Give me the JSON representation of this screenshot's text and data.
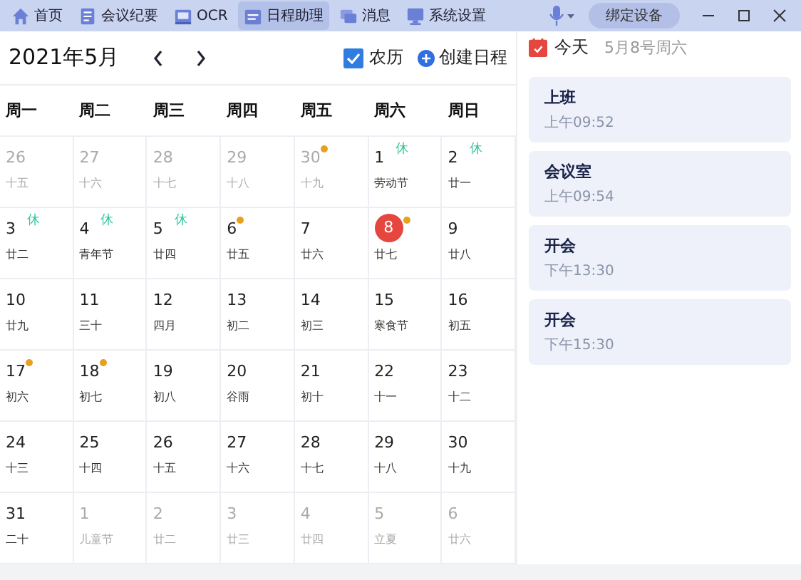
{
  "nav": [
    {
      "label": "首页",
      "selected": false
    },
    {
      "label": "会议纪要",
      "selected": false
    },
    {
      "label": "OCR",
      "selected": false
    },
    {
      "label": "日程助理",
      "selected": true
    },
    {
      "label": "消息",
      "selected": false
    },
    {
      "label": "系统设置",
      "selected": false
    }
  ],
  "bind_button": "绑定设备",
  "calendar": {
    "title": "2021年5月",
    "lunar_toggle": {
      "label": "农历",
      "checked": true
    },
    "create_button": "创建日程",
    "weekdays": [
      "周一",
      "周二",
      "周三",
      "周四",
      "周五",
      "周六",
      "周日"
    ],
    "weeks": [
      [
        {
          "day": "26",
          "lunar": "十五",
          "other_month": true,
          "event": false,
          "today": false
        },
        {
          "day": "27",
          "lunar": "十六",
          "other_month": true,
          "event": false,
          "today": false
        },
        {
          "day": "28",
          "lunar": "十七",
          "other_month": true,
          "event": false,
          "today": false
        },
        {
          "day": "29",
          "lunar": "十八",
          "other_month": true,
          "event": false,
          "today": false
        },
        {
          "day": "30",
          "lunar": "十九",
          "other_month": true,
          "event": true,
          "today": false
        },
        {
          "day": "1",
          "lunar": "劳动节",
          "other_month": false,
          "event": false,
          "today": false,
          "badge": "休"
        },
        {
          "day": "2",
          "lunar": "廿一",
          "other_month": false,
          "event": false,
          "today": false,
          "badge": "休"
        }
      ],
      [
        {
          "day": "3",
          "lunar": "廿二",
          "other_month": false,
          "event": false,
          "today": false,
          "badge": "休"
        },
        {
          "day": "4",
          "lunar": "青年节",
          "other_month": false,
          "event": false,
          "today": false,
          "badge": "休"
        },
        {
          "day": "5",
          "lunar": "廿四",
          "other_month": false,
          "event": false,
          "today": false,
          "badge": "休"
        },
        {
          "day": "6",
          "lunar": "廿五",
          "other_month": false,
          "event": true,
          "today": false
        },
        {
          "day": "7",
          "lunar": "廿六",
          "other_month": false,
          "event": false,
          "today": false
        },
        {
          "day": "8",
          "lunar": "廿七",
          "other_month": false,
          "event": true,
          "today": true
        },
        {
          "day": "9",
          "lunar": "廿八",
          "other_month": false,
          "event": false,
          "today": false
        }
      ],
      [
        {
          "day": "10",
          "lunar": "廿九",
          "other_month": false,
          "event": false,
          "today": false
        },
        {
          "day": "11",
          "lunar": "三十",
          "other_month": false,
          "event": false,
          "today": false
        },
        {
          "day": "12",
          "lunar": "四月",
          "other_month": false,
          "event": false,
          "today": false
        },
        {
          "day": "13",
          "lunar": "初二",
          "other_month": false,
          "event": false,
          "today": false
        },
        {
          "day": "14",
          "lunar": "初三",
          "other_month": false,
          "event": false,
          "today": false
        },
        {
          "day": "15",
          "lunar": "寒食节",
          "other_month": false,
          "event": false,
          "today": false
        },
        {
          "day": "16",
          "lunar": "初五",
          "other_month": false,
          "event": false,
          "today": false
        }
      ],
      [
        {
          "day": "17",
          "lunar": "初六",
          "other_month": false,
          "event": true,
          "today": false
        },
        {
          "day": "18",
          "lunar": "初七",
          "other_month": false,
          "event": true,
          "today": false
        },
        {
          "day": "19",
          "lunar": "初八",
          "other_month": false,
          "event": false,
          "today": false
        },
        {
          "day": "20",
          "lunar": "谷雨",
          "other_month": false,
          "event": false,
          "today": false
        },
        {
          "day": "21",
          "lunar": "初十",
          "other_month": false,
          "event": false,
          "today": false
        },
        {
          "day": "22",
          "lunar": "十一",
          "other_month": false,
          "event": false,
          "today": false
        },
        {
          "day": "23",
          "lunar": "十二",
          "other_month": false,
          "event": false,
          "today": false
        }
      ],
      [
        {
          "day": "24",
          "lunar": "十三",
          "other_month": false,
          "event": false,
          "today": false
        },
        {
          "day": "25",
          "lunar": "十四",
          "other_month": false,
          "event": false,
          "today": false
        },
        {
          "day": "26",
          "lunar": "十五",
          "other_month": false,
          "event": false,
          "today": false
        },
        {
          "day": "27",
          "lunar": "十六",
          "other_month": false,
          "event": false,
          "today": false
        },
        {
          "day": "28",
          "lunar": "十七",
          "other_month": false,
          "event": false,
          "today": false
        },
        {
          "day": "29",
          "lunar": "十八",
          "other_month": false,
          "event": false,
          "today": false
        },
        {
          "day": "30",
          "lunar": "十九",
          "other_month": false,
          "event": false,
          "today": false
        }
      ],
      [
        {
          "day": "31",
          "lunar": "二十",
          "other_month": false,
          "event": false,
          "today": false
        },
        {
          "day": "1",
          "lunar": "儿童节",
          "other_month": true,
          "event": false,
          "today": false
        },
        {
          "day": "2",
          "lunar": "廿二",
          "other_month": true,
          "event": false,
          "today": false
        },
        {
          "day": "3",
          "lunar": "廿三",
          "other_month": true,
          "event": false,
          "today": false
        },
        {
          "day": "4",
          "lunar": "廿四",
          "other_month": true,
          "event": false,
          "today": false
        },
        {
          "day": "5",
          "lunar": "立夏",
          "other_month": true,
          "event": false,
          "today": false
        },
        {
          "day": "6",
          "lunar": "廿六",
          "other_month": true,
          "event": false,
          "today": false
        }
      ]
    ]
  },
  "today_panel": {
    "title": "今天",
    "date": "5月8号周六",
    "events": [
      {
        "title": "上班",
        "time": "上午09:52"
      },
      {
        "title": "会议室",
        "time": "上午09:54"
      },
      {
        "title": "开会",
        "time": "下午13:30"
      },
      {
        "title": "开会",
        "time": "下午15:30"
      }
    ]
  }
}
